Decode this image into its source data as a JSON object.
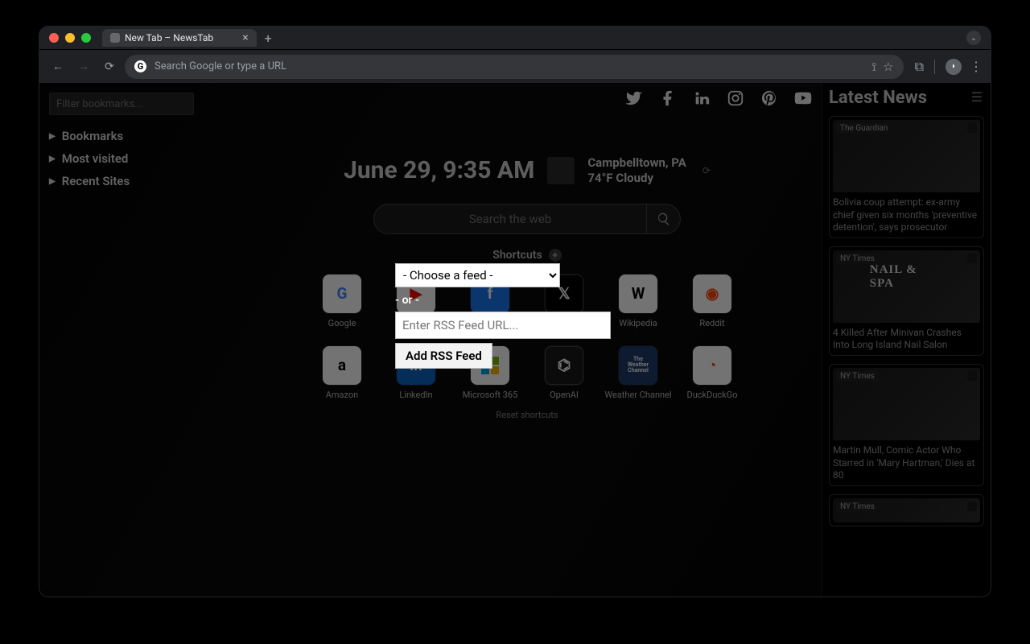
{
  "window": {
    "tab_title": "New Tab – NewsTab"
  },
  "toolbar": {
    "omnibox_placeholder": "Search Google or type a URL"
  },
  "left_pane": {
    "filter_placeholder": "Filter bookmarks...",
    "items": [
      "Bookmarks",
      "Most visited",
      "Recent Sites"
    ]
  },
  "main": {
    "datetime": "June 29, 9:35 AM",
    "weather": {
      "location": "Campbelltown, PA",
      "condition": "74°F Cloudy"
    },
    "search_placeholder": "Search the web",
    "shortcuts_label": "Shortcuts",
    "reset_label": "Reset shortcuts",
    "shortcuts": [
      {
        "label": "Google"
      },
      {
        "label": "YouTube"
      },
      {
        "label": "Facebook"
      },
      {
        "label": "Twitter"
      },
      {
        "label": "Wikipedia"
      },
      {
        "label": "Reddit"
      },
      {
        "label": "Amazon"
      },
      {
        "label": "LinkedIn"
      },
      {
        "label": "Microsoft 365"
      },
      {
        "label": "OpenAI"
      },
      {
        "label": "Weather Channel"
      },
      {
        "label": "DuckDuckGo"
      }
    ]
  },
  "modal": {
    "choose_feed": "- Choose a feed -",
    "or_label": "- or -",
    "rss_placeholder": "Enter RSS Feed URL...",
    "add_button": "Add RSS Feed"
  },
  "news": {
    "title": "Latest News",
    "items": [
      {
        "source": "The Guardian",
        "title": "Bolivia coup attempt: ex-army chief given six months 'preventive detention', says prosecutor"
      },
      {
        "source": "NY Times",
        "title": "4 Killed After Minivan Crashes Into Long Island Nail Salon",
        "sign": "NAIL & SPA"
      },
      {
        "source": "NY Times",
        "title": "Martin Mull, Comic Actor Who Starred in 'Mary Hartman,' Dies at 80"
      },
      {
        "source": "NY Times",
        "title": ""
      }
    ]
  }
}
